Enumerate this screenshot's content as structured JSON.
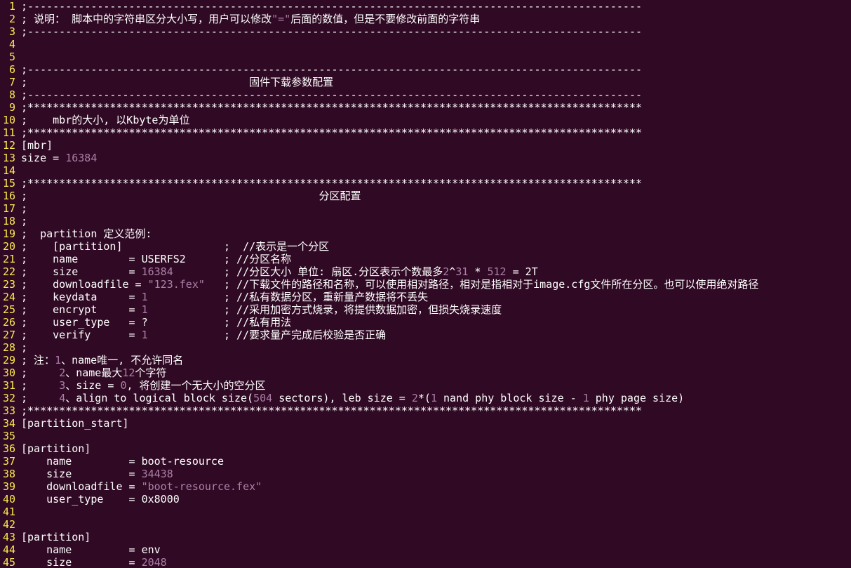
{
  "editor": {
    "colors": {
      "background": "#300a24",
      "line_number": "#fce94f",
      "text": "#ffffff",
      "number_literal": "#ad7fa8",
      "string_literal": "#ad7fa8"
    },
    "lines": [
      {
        "n": "1",
        "tokens": [
          {
            "t": "txt",
            "v": ";-------------------------------------------------------------------------------------------------"
          }
        ]
      },
      {
        "n": "2",
        "tokens": [
          {
            "t": "txt",
            "v": "; 说明： 脚本中的字符串区分大小写，用户可以修改"
          },
          {
            "t": "str",
            "v": "\"=\""
          },
          {
            "t": "txt",
            "v": "后面的数值，但是不要修改前面的字符串"
          }
        ]
      },
      {
        "n": "3",
        "tokens": [
          {
            "t": "txt",
            "v": ";-------------------------------------------------------------------------------------------------"
          }
        ]
      },
      {
        "n": "4",
        "tokens": []
      },
      {
        "n": "5",
        "tokens": []
      },
      {
        "n": "6",
        "tokens": [
          {
            "t": "txt",
            "v": ";-------------------------------------------------------------------------------------------------"
          }
        ]
      },
      {
        "n": "7",
        "tokens": [
          {
            "t": "txt",
            "v": ";                                   固件下载参数配置"
          }
        ]
      },
      {
        "n": "8",
        "tokens": [
          {
            "t": "txt",
            "v": ";-------------------------------------------------------------------------------------------------"
          }
        ]
      },
      {
        "n": "9",
        "tokens": [
          {
            "t": "txt",
            "v": ";*************************************************************************************************"
          }
        ]
      },
      {
        "n": "10",
        "tokens": [
          {
            "t": "txt",
            "v": ";    mbr的大小, 以Kbyte为单位"
          }
        ]
      },
      {
        "n": "11",
        "tokens": [
          {
            "t": "txt",
            "v": ";*************************************************************************************************"
          }
        ]
      },
      {
        "n": "12",
        "tokens": [
          {
            "t": "txt",
            "v": "[mbr]"
          }
        ]
      },
      {
        "n": "13",
        "tokens": [
          {
            "t": "txt",
            "v": "size = "
          },
          {
            "t": "num",
            "v": "16384"
          }
        ]
      },
      {
        "n": "14",
        "tokens": []
      },
      {
        "n": "15",
        "tokens": [
          {
            "t": "txt",
            "v": ";*************************************************************************************************"
          }
        ]
      },
      {
        "n": "16",
        "tokens": [
          {
            "t": "txt",
            "v": ";                                              分区配置"
          }
        ]
      },
      {
        "n": "17",
        "tokens": [
          {
            "t": "txt",
            "v": ";"
          }
        ]
      },
      {
        "n": "18",
        "tokens": [
          {
            "t": "txt",
            "v": ";"
          }
        ]
      },
      {
        "n": "19",
        "tokens": [
          {
            "t": "txt",
            "v": ";  partition 定义范例:"
          }
        ]
      },
      {
        "n": "20",
        "tokens": [
          {
            "t": "txt",
            "v": ";    [partition]                ;  //表示是一个分区"
          }
        ]
      },
      {
        "n": "21",
        "tokens": [
          {
            "t": "txt",
            "v": ";    name        = USERFS2      ; //分区名称"
          }
        ]
      },
      {
        "n": "22",
        "tokens": [
          {
            "t": "txt",
            "v": ";    size        = "
          },
          {
            "t": "num",
            "v": "16384"
          },
          {
            "t": "txt",
            "v": "        ; //分区大小 单位: 扇区.分区表示个数最多"
          },
          {
            "t": "num",
            "v": "2"
          },
          {
            "t": "txt",
            "v": "^"
          },
          {
            "t": "num",
            "v": "31"
          },
          {
            "t": "txt",
            "v": " * "
          },
          {
            "t": "num",
            "v": "512"
          },
          {
            "t": "txt",
            "v": " = 2T"
          }
        ]
      },
      {
        "n": "23",
        "tokens": [
          {
            "t": "txt",
            "v": ";    downloadfile = "
          },
          {
            "t": "str",
            "v": "\"123.fex\""
          },
          {
            "t": "txt",
            "v": "   ; //下载文件的路径和名称，可以使用相对路径，相对是指相对于image.cfg文件所在分区。也可以使用绝对路径"
          }
        ]
      },
      {
        "n": "24",
        "tokens": [
          {
            "t": "txt",
            "v": ";    keydata     = "
          },
          {
            "t": "num",
            "v": "1"
          },
          {
            "t": "txt",
            "v": "            ; //私有数据分区，重新量产数据将不丢失"
          }
        ]
      },
      {
        "n": "25",
        "tokens": [
          {
            "t": "txt",
            "v": ";    encrypt     = "
          },
          {
            "t": "num",
            "v": "1"
          },
          {
            "t": "txt",
            "v": "            ; //采用加密方式烧录，将提供数据加密，但损失烧录速度"
          }
        ]
      },
      {
        "n": "26",
        "tokens": [
          {
            "t": "txt",
            "v": ";    user_type   = ?            ; //私有用法"
          }
        ]
      },
      {
        "n": "27",
        "tokens": [
          {
            "t": "txt",
            "v": ";    verify      = "
          },
          {
            "t": "num",
            "v": "1"
          },
          {
            "t": "txt",
            "v": "            ; //要求量产完成后校验是否正确"
          }
        ]
      },
      {
        "n": "28",
        "tokens": [
          {
            "t": "txt",
            "v": ";"
          }
        ]
      },
      {
        "n": "29",
        "tokens": [
          {
            "t": "txt",
            "v": "; 注："
          },
          {
            "t": "num",
            "v": "1"
          },
          {
            "t": "txt",
            "v": "、name唯一, 不允许同名"
          }
        ]
      },
      {
        "n": "30",
        "tokens": [
          {
            "t": "txt",
            "v": ";     "
          },
          {
            "t": "num",
            "v": "2"
          },
          {
            "t": "txt",
            "v": "、name最大"
          },
          {
            "t": "num",
            "v": "12"
          },
          {
            "t": "txt",
            "v": "个字符"
          }
        ]
      },
      {
        "n": "31",
        "tokens": [
          {
            "t": "txt",
            "v": ";     "
          },
          {
            "t": "num",
            "v": "3"
          },
          {
            "t": "txt",
            "v": "、size = "
          },
          {
            "t": "num",
            "v": "0"
          },
          {
            "t": "txt",
            "v": ", 将创建一个无大小的空分区"
          }
        ]
      },
      {
        "n": "32",
        "tokens": [
          {
            "t": "txt",
            "v": ";     "
          },
          {
            "t": "num",
            "v": "4"
          },
          {
            "t": "txt",
            "v": "、align to logical block size("
          },
          {
            "t": "num",
            "v": "504"
          },
          {
            "t": "txt",
            "v": " sectors), leb size = "
          },
          {
            "t": "num",
            "v": "2"
          },
          {
            "t": "txt",
            "v": "*("
          },
          {
            "t": "num",
            "v": "1"
          },
          {
            "t": "txt",
            "v": " nand phy block size - "
          },
          {
            "t": "num",
            "v": "1"
          },
          {
            "t": "txt",
            "v": " phy page size)"
          }
        ]
      },
      {
        "n": "33",
        "tokens": [
          {
            "t": "txt",
            "v": ";*************************************************************************************************"
          }
        ]
      },
      {
        "n": "34",
        "tokens": [
          {
            "t": "txt",
            "v": "[partition_start]"
          }
        ]
      },
      {
        "n": "35",
        "tokens": []
      },
      {
        "n": "36",
        "tokens": [
          {
            "t": "txt",
            "v": "[partition]"
          }
        ]
      },
      {
        "n": "37",
        "tokens": [
          {
            "t": "txt",
            "v": "    name         = boot-resource"
          }
        ]
      },
      {
        "n": "38",
        "tokens": [
          {
            "t": "txt",
            "v": "    size         = "
          },
          {
            "t": "num",
            "v": "34438"
          }
        ]
      },
      {
        "n": "39",
        "tokens": [
          {
            "t": "txt",
            "v": "    downloadfile = "
          },
          {
            "t": "str",
            "v": "\"boot-resource.fex\""
          }
        ]
      },
      {
        "n": "40",
        "tokens": [
          {
            "t": "txt",
            "v": "    user_type    = 0x8000"
          }
        ]
      },
      {
        "n": "41",
        "tokens": []
      },
      {
        "n": "42",
        "tokens": []
      },
      {
        "n": "43",
        "tokens": [
          {
            "t": "txt",
            "v": "[partition]"
          }
        ]
      },
      {
        "n": "44",
        "tokens": [
          {
            "t": "txt",
            "v": "    name         = env"
          }
        ]
      },
      {
        "n": "45",
        "tokens": [
          {
            "t": "txt",
            "v": "    size         = "
          },
          {
            "t": "num",
            "v": "2048"
          }
        ]
      }
    ]
  }
}
